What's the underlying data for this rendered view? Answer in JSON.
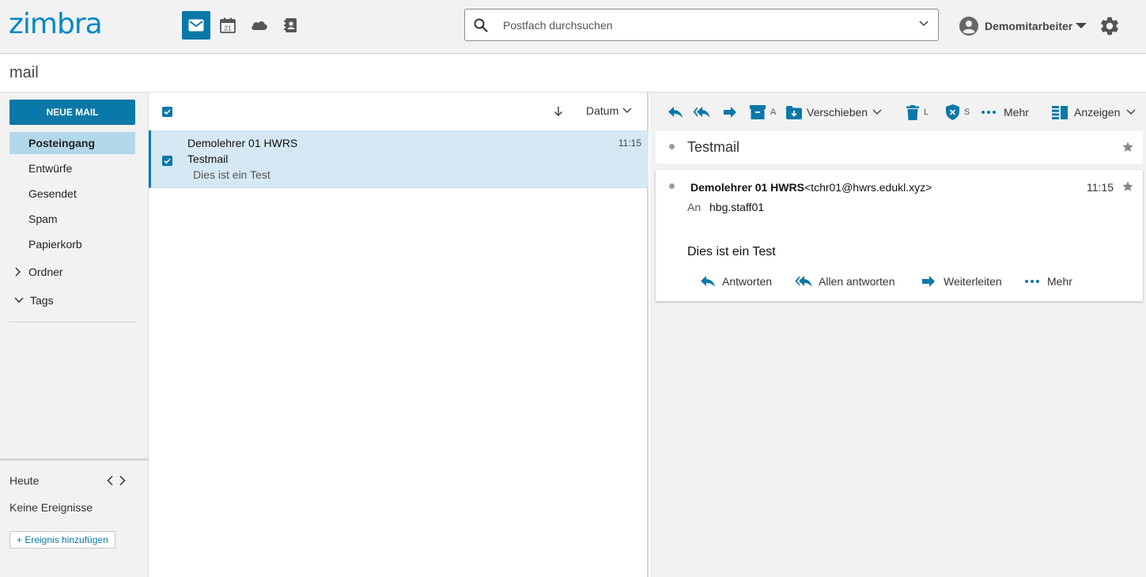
{
  "app": {
    "logo": "zimbra",
    "accent": "#0a78a8",
    "apps": [
      {
        "name": "mail",
        "icon": "mail-icon",
        "active": true
      },
      {
        "name": "calendar",
        "icon": "calendar-icon",
        "badge": "21"
      },
      {
        "name": "cloud",
        "icon": "cloud-icon"
      },
      {
        "name": "contacts",
        "icon": "contacts-icon"
      }
    ]
  },
  "search": {
    "placeholder": "Postfach durchsuchen"
  },
  "user": {
    "name": "Demomitarbeiter"
  },
  "section_title": "mail",
  "sidebar": {
    "new_mail": "NEUE MAIL",
    "folders": [
      {
        "label": "Posteingang",
        "active": true
      },
      {
        "label": "Entwürfe"
      },
      {
        "label": "Gesendet"
      },
      {
        "label": "Spam"
      },
      {
        "label": "Papierkorb"
      }
    ],
    "groups": [
      {
        "label": "Ordner",
        "icon": "chevron-right-icon"
      },
      {
        "label": "Tags",
        "icon": "chevron-down-icon"
      }
    ],
    "calendar": {
      "today": "Heute",
      "no_events": "Keine Ereignisse",
      "add_event": "+ Ereignis hinzufügen"
    }
  },
  "list": {
    "sort_label": "Datum",
    "messages": [
      {
        "from": "Demolehrer 01 HWRS",
        "subject": "Testmail",
        "preview": "Dies ist ein Test",
        "time": "11:15",
        "selected": true
      }
    ]
  },
  "reader": {
    "toolbar": {
      "archive": "A",
      "move": "Verschieben",
      "delete": "L",
      "spam": "S",
      "more": "Mehr",
      "view": "Anzeigen"
    },
    "subject": "Testmail",
    "message": {
      "sender_name": "Demolehrer 01 HWRS",
      "sender_email": "<tchr01@hwrs.edukl.xyz>",
      "time": "11:15",
      "to_label": "An",
      "to": "hbg.staff01",
      "body": "Dies ist ein Test",
      "actions": {
        "reply": "Antworten",
        "reply_all": "Allen antworten",
        "forward": "Weiterleiten",
        "more": "Mehr"
      }
    }
  }
}
